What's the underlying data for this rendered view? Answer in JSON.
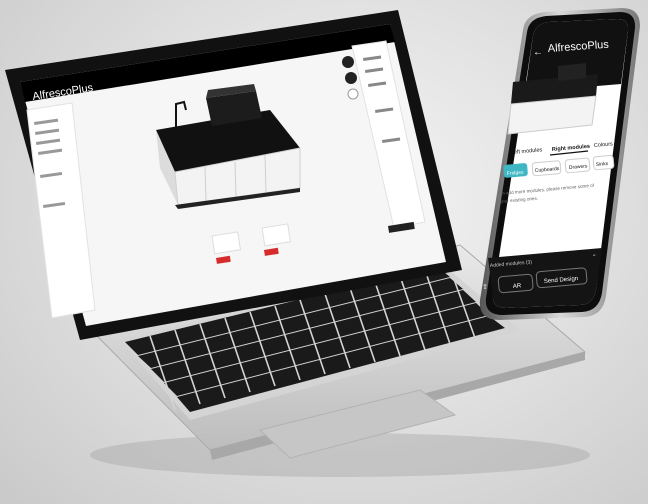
{
  "laptop": {
    "brand_logo": "AlfrescoPlus",
    "canvas_background": "#f2f2f2"
  },
  "phone": {
    "brand_logo": "AlfrescoPlus",
    "back_icon": "arrow-left-icon",
    "tabs": [
      {
        "label": "Left modules",
        "active": false
      },
      {
        "label": "Right modules",
        "active": true
      },
      {
        "label": "Colours",
        "active": false
      }
    ],
    "categories": [
      {
        "label": "Fridges",
        "active": true
      },
      {
        "label": "Cupboards",
        "active": false
      },
      {
        "label": "Drawers",
        "active": false
      },
      {
        "label": "Sinks",
        "active": false
      }
    ],
    "info_text_line1": "To add more modules, please remove some of",
    "info_text_line2": "your existing ones.",
    "added_modules_label": "Added modules (3)",
    "ar_label": "AR",
    "send_label": "Send Design",
    "accent_color": "#3fb6c4"
  }
}
